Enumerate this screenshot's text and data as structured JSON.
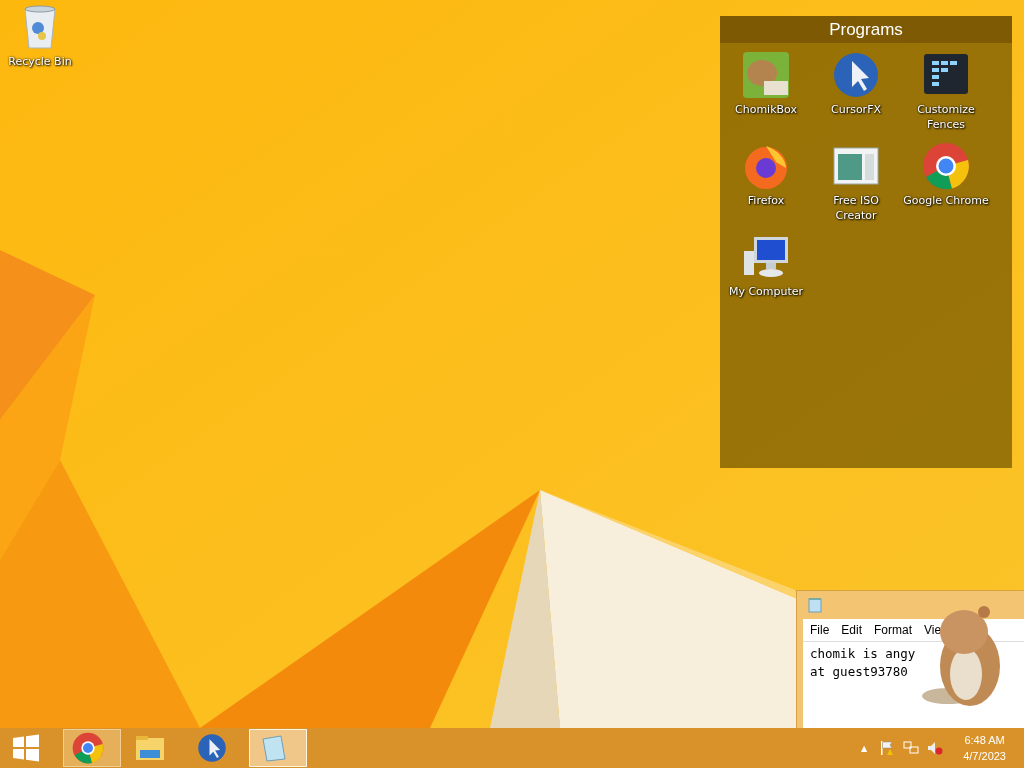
{
  "desktop_icons": [
    {
      "kind": "recycle-bin",
      "label": "Recycle Bin"
    }
  ],
  "fence": {
    "title": "Programs",
    "items": [
      {
        "kind": "chomikbox",
        "label": "ChomikBox"
      },
      {
        "kind": "cursor",
        "label": "CursorFX"
      },
      {
        "kind": "fences",
        "label": "Customize Fences"
      },
      {
        "kind": "firefox",
        "label": "Firefox"
      },
      {
        "kind": "iso",
        "label": "Free ISO Creator"
      },
      {
        "kind": "chrome",
        "label": "Google Chrome"
      },
      {
        "kind": "computer",
        "label": "My Computer"
      }
    ]
  },
  "notepad": {
    "menu": [
      "File",
      "Edit",
      "Format",
      "Vie"
    ],
    "lines": [
      "chomik is angy",
      "at guest93780"
    ]
  },
  "taskbar": {
    "apps": [
      {
        "kind": "start",
        "hovered": false,
        "active": false
      },
      {
        "kind": "chrome",
        "hovered": true,
        "active": false
      },
      {
        "kind": "explorer",
        "hovered": false,
        "active": false
      },
      {
        "kind": "cursor",
        "hovered": false,
        "active": false
      },
      {
        "kind": "notepad",
        "hovered": false,
        "active": true
      }
    ],
    "tray": {
      "chevron": "▲",
      "time": "6:48 AM",
      "date": "4/7/2023"
    }
  }
}
